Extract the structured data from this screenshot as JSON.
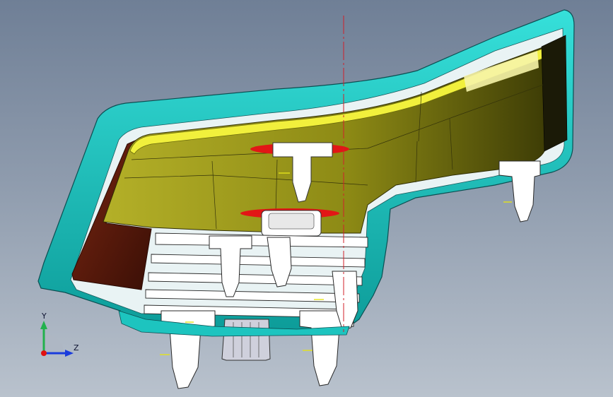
{
  "viewport": {
    "background_top": "#6f7f96",
    "background_bottom": "#b9c2cd"
  },
  "model": {
    "shell_color": "#17c3bf",
    "cover_color": "#6b6a0c",
    "cover_highlight_color": "#ecec3a",
    "dark_panel_color": "#5a1a0c",
    "feature_color": "#ffffff",
    "marker_color": "#e01010",
    "axis_line_color": "#d0202a"
  },
  "triad": {
    "y_label": "Y",
    "z_label": "Z",
    "y_color": "#22b14c",
    "z_color": "#1a3cdc",
    "origin_color": "#e01010"
  }
}
